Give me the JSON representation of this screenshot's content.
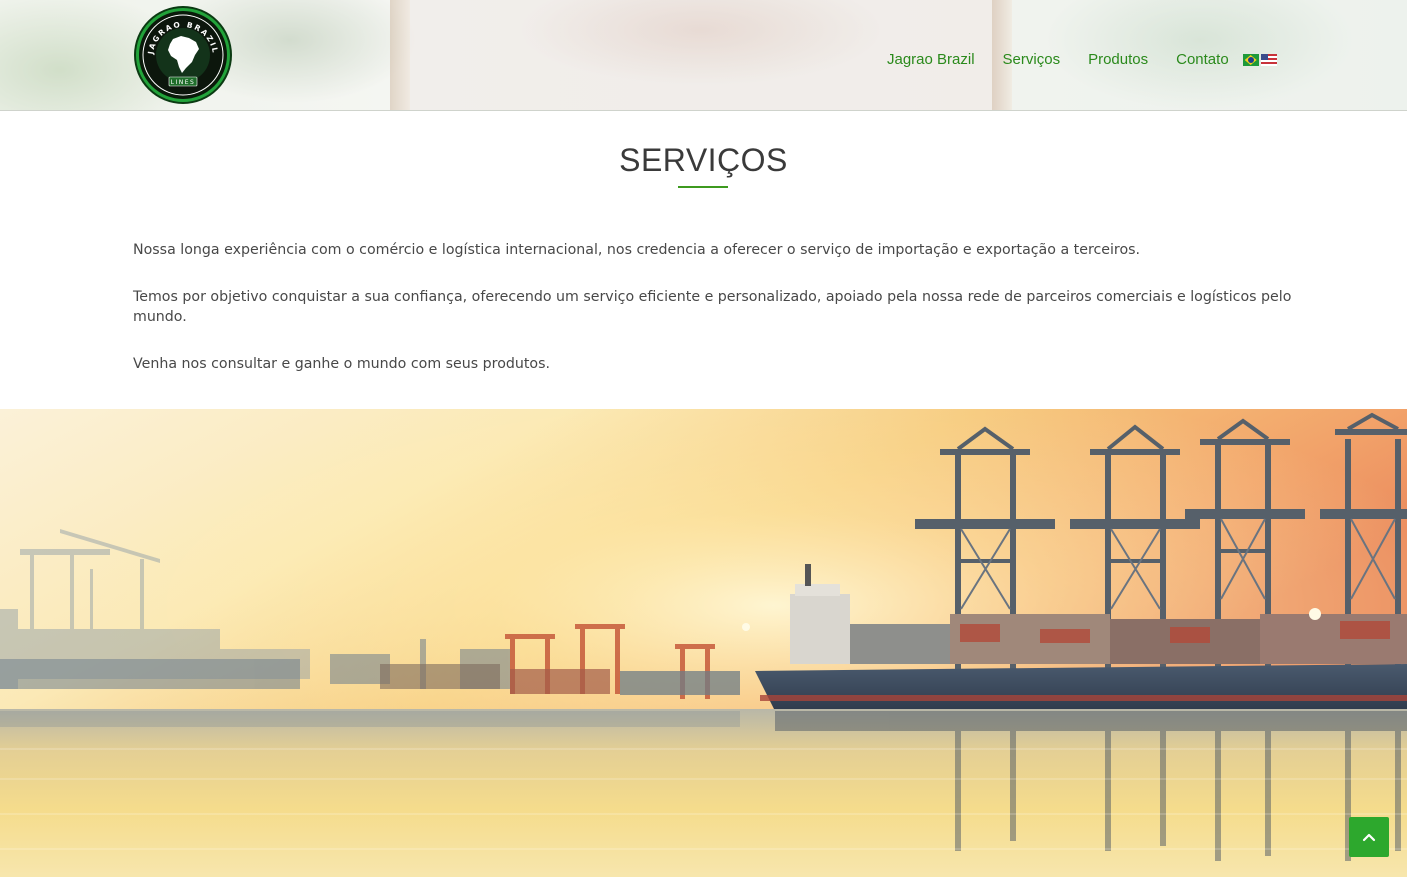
{
  "header": {
    "logo": {
      "name": "jagrao-brazil-lines-logo",
      "text_top": "JAGRAO BRAZIL",
      "text_bottom": "LINES"
    },
    "nav": [
      {
        "label": "Jagrao Brazil"
      },
      {
        "label": "Serviços"
      },
      {
        "label": "Produtos"
      },
      {
        "label": "Contato"
      }
    ],
    "languages": [
      {
        "icon": "brazil-flag-icon"
      },
      {
        "icon": "usa-flag-icon"
      }
    ]
  },
  "services": {
    "title": "SERVIÇOS",
    "paragraphs": [
      "Nossa longa experiência com o comércio e logística internacional, nos credencia a oferecer o serviço de importação e exportação a terceiros.",
      "Temos por objetivo conquistar a sua confiança, oferecendo um serviço eficiente e personalizado, apoiado pela nossa rede de parceiros comerciais e logísticos pelo mundo.",
      "Venha nos consultar e ganhe o mundo com seus produtos."
    ]
  },
  "banner": {
    "image": "port-cranes-cargo-ship-sunset"
  },
  "back_to_top": {
    "icon": "chevron-up-icon"
  },
  "colors": {
    "accent": "#2b8a1c",
    "button": "#2da82d",
    "text": "#484848",
    "title": "#3a3a3a"
  }
}
